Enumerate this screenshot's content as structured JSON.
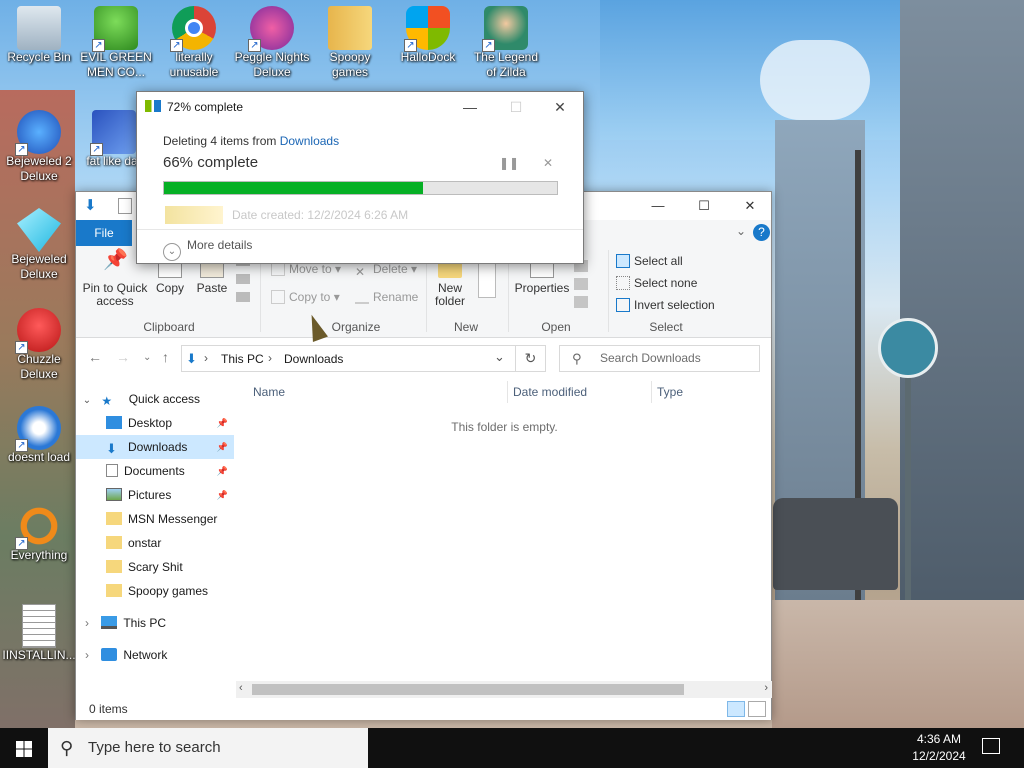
{
  "desktop": {
    "icons": [
      {
        "label": "Recycle Bin"
      },
      {
        "label": "EVIL GREEN MEN CO..."
      },
      {
        "label": "literally unusable"
      },
      {
        "label": "Peggle Nights Deluxe"
      },
      {
        "label": "Spoopy games"
      },
      {
        "label": "HalloDock"
      },
      {
        "label": "The Legend of Zilda"
      },
      {
        "label": "Bejeweled 2 Deluxe"
      },
      {
        "label": "fat like dar"
      },
      {
        "label": "Bejeweled Deluxe"
      },
      {
        "label": "Chuzzle Deluxe"
      },
      {
        "label": "doesnt load"
      },
      {
        "label": "Everything"
      },
      {
        "label": "IINSTALLIN..."
      }
    ]
  },
  "explorer": {
    "file_tab": "File",
    "ribbon": {
      "pin_label": "Pin to Quick access",
      "copy_label": "Copy",
      "paste_label": "Paste",
      "clipboard_group": "Clipboard",
      "move_to": "Move to",
      "delete": "Delete",
      "copy_to": "Copy to",
      "rename": "Rename",
      "organize_group": "Organize",
      "new_folder": "New folder",
      "new_group": "New",
      "properties": "Properties",
      "open_group": "Open",
      "select_all": "Select all",
      "select_none": "Select none",
      "invert_selection": "Invert selection",
      "select_group": "Select"
    },
    "address": {
      "crumb1": "This PC",
      "crumb2": "Downloads"
    },
    "search_placeholder": "Search Downloads",
    "nav": {
      "quick_access": "Quick access",
      "items": [
        {
          "label": "Desktop",
          "pinned": true
        },
        {
          "label": "Downloads",
          "pinned": true
        },
        {
          "label": "Documents",
          "pinned": true
        },
        {
          "label": "Pictures",
          "pinned": true
        },
        {
          "label": "MSN Messenger",
          "pinned": false
        },
        {
          "label": "onstar",
          "pinned": false
        },
        {
          "label": "Scary Shit",
          "pinned": false
        },
        {
          "label": "Spoopy games",
          "pinned": false
        }
      ],
      "this_pc": "This PC",
      "network": "Network"
    },
    "columns": {
      "name": "Name",
      "date_modified": "Date modified",
      "type": "Type"
    },
    "empty_message": "This folder is empty.",
    "status": "0 items"
  },
  "progress_dialog": {
    "title": "72% complete",
    "deleting_prefix": "Deleting 4 items from",
    "source": "Downloads",
    "percent_label": "66% complete",
    "progress": 0.66,
    "ghost_text": "Date created: 12/2/2024 6:26 AM",
    "more_details": "More details"
  },
  "taskbar": {
    "search_placeholder": "Type here to search",
    "time": "4:36 AM",
    "date": "12/2/2024"
  },
  "colors": {
    "accent": "#1979ca",
    "progress": "#06b025",
    "selection": "#cce8ff"
  }
}
